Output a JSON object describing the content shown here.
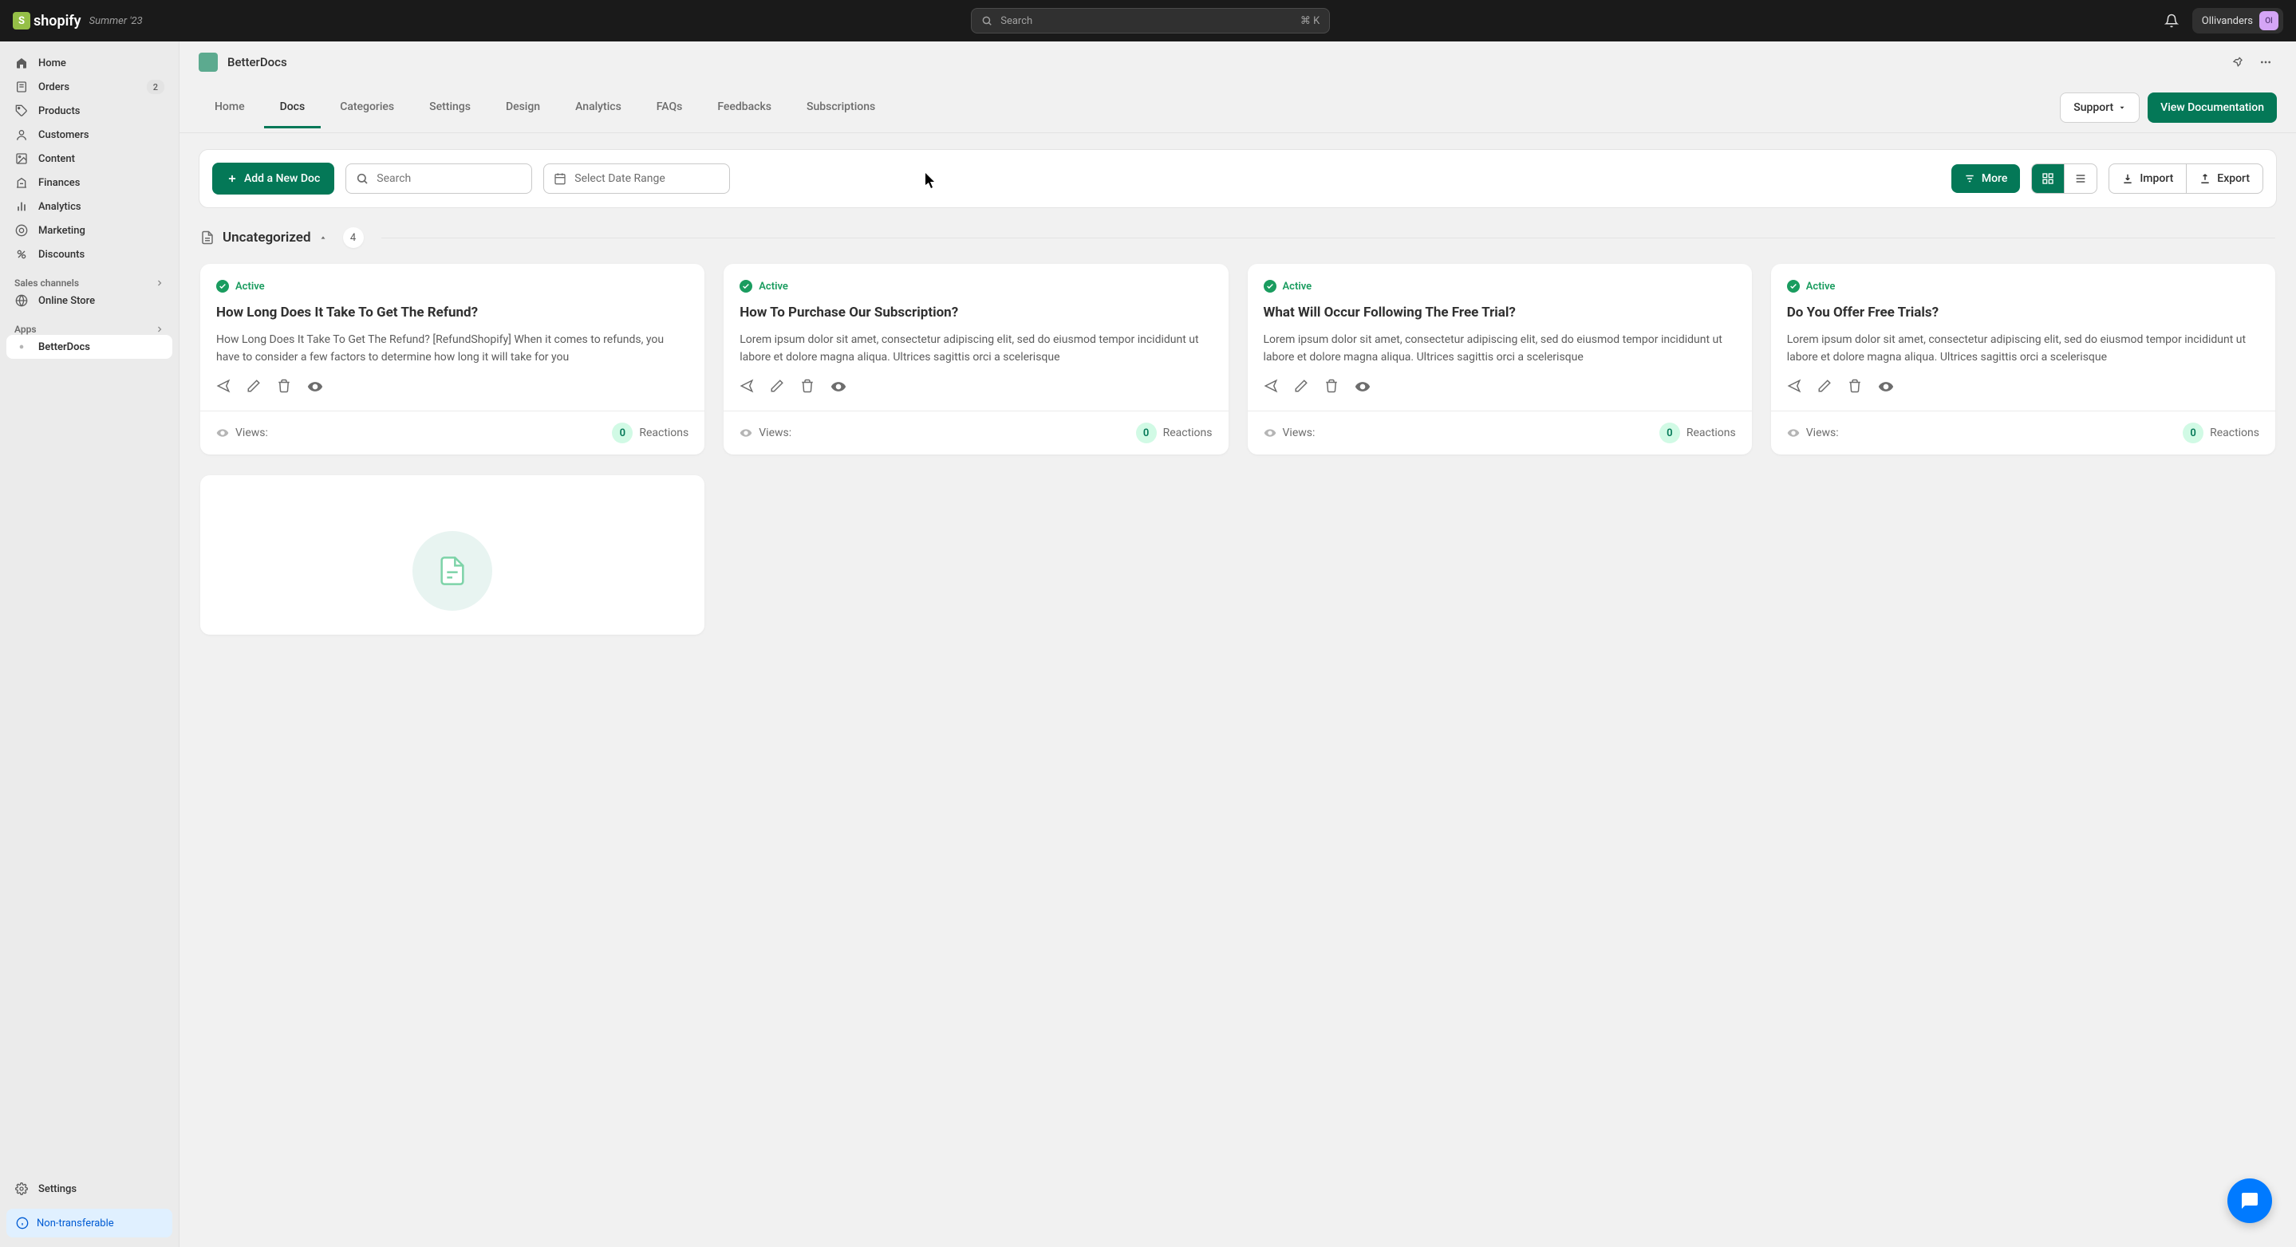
{
  "topbar": {
    "logo_text": "shopify",
    "season_tag": "Summer '23",
    "search_placeholder": "Search",
    "search_shortcut": "⌘ K",
    "user_name": "Ollivanders",
    "user_initials": "Ol"
  },
  "sidebar": {
    "items": [
      {
        "label": "Home",
        "icon": "home"
      },
      {
        "label": "Orders",
        "icon": "orders",
        "badge": "2"
      },
      {
        "label": "Products",
        "icon": "products"
      },
      {
        "label": "Customers",
        "icon": "customers"
      },
      {
        "label": "Content",
        "icon": "content"
      },
      {
        "label": "Finances",
        "icon": "finances"
      },
      {
        "label": "Analytics",
        "icon": "analytics"
      },
      {
        "label": "Marketing",
        "icon": "marketing"
      },
      {
        "label": "Discounts",
        "icon": "discounts"
      }
    ],
    "sales_channels_label": "Sales channels",
    "online_store_label": "Online Store",
    "apps_label": "Apps",
    "app_item_label": "BetterDocs",
    "settings_label": "Settings",
    "non_transferable_label": "Non-transferable"
  },
  "app": {
    "title": "BetterDocs",
    "tabs": [
      "Home",
      "Docs",
      "Categories",
      "Settings",
      "Design",
      "Analytics",
      "FAQs",
      "Feedbacks",
      "Subscriptions"
    ],
    "active_tab_index": 1,
    "support_btn": "Support",
    "view_docs_btn": "View Documentation"
  },
  "toolbar": {
    "add_btn": "Add a New Doc",
    "search_placeholder": "Search",
    "date_placeholder": "Select Date Range",
    "more_btn": "More",
    "import_btn": "Import",
    "export_btn": "Export"
  },
  "section": {
    "title": "Uncategorized",
    "count": "4"
  },
  "cards": [
    {
      "status": "Active",
      "title": "How Long Does It Take To Get The Refund?",
      "desc": "How Long Does It Take To Get The Refund? [RefundShopify] When it comes to refunds, you have to consider a few factors to determine how long it will take for you",
      "views_label": "Views:",
      "reactions": "0",
      "reactions_label": "Reactions"
    },
    {
      "status": "Active",
      "title": "How To Purchase Our Subscription?",
      "desc": "Lorem ipsum dolor sit amet, consectetur adipiscing elit, sed do eiusmod tempor incididunt ut labore et dolore magna aliqua. Ultrices sagittis orci a scelerisque",
      "views_label": "Views:",
      "reactions": "0",
      "reactions_label": "Reactions"
    },
    {
      "status": "Active",
      "title": "What Will Occur Following The Free Trial?",
      "desc": "Lorem ipsum dolor sit amet, consectetur adipiscing elit, sed do eiusmod tempor incididunt ut labore et dolore magna aliqua. Ultrices sagittis orci a scelerisque",
      "views_label": "Views:",
      "reactions": "0",
      "reactions_label": "Reactions"
    },
    {
      "status": "Active",
      "title": "Do You Offer Free Trials?",
      "desc": "Lorem ipsum dolor sit amet, consectetur adipiscing elit, sed do eiusmod tempor incididunt ut labore et dolore magna aliqua. Ultrices sagittis orci a scelerisque",
      "views_label": "Views:",
      "reactions": "0",
      "reactions_label": "Reactions"
    }
  ]
}
